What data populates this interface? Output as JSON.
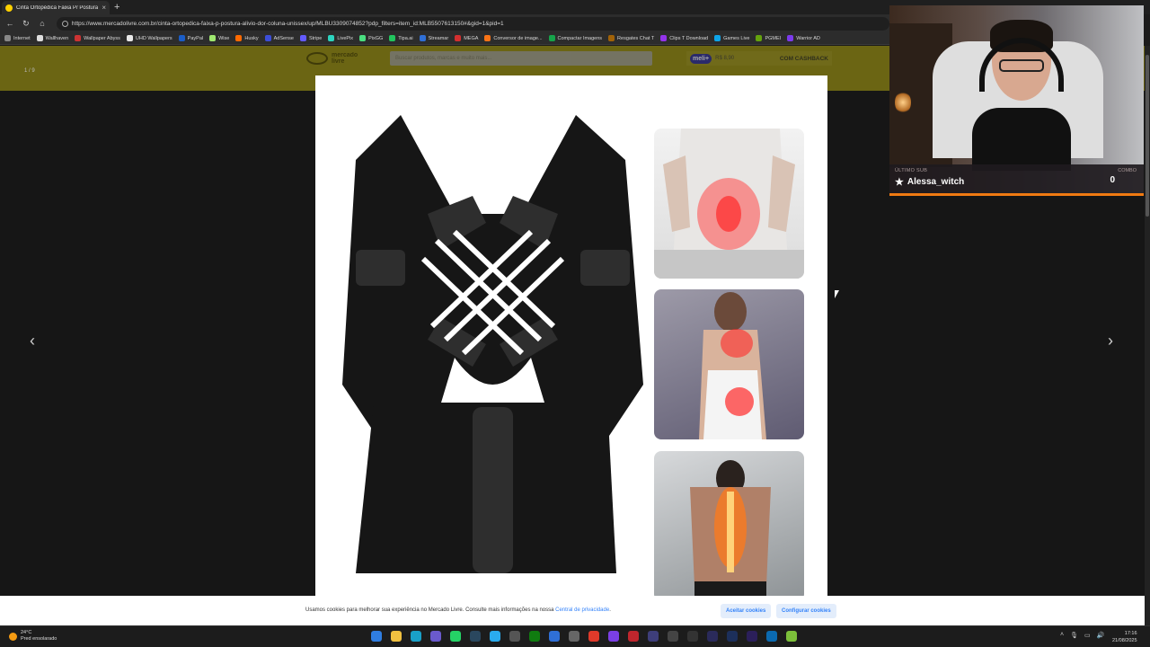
{
  "browser": {
    "tab_title": "Cinta Ortopédica Faixa P/ Postura",
    "new_tab": "+",
    "close": "×",
    "url": "https://www.mercadolivre.com.br/cinta-ortopedica-faixa-p-postura-alivio-dor-coluna-unissex/up/MLBU3309074852?pdp_filters=item_id:MLB5507613150#&gid=1&pid=1",
    "bookmarks": [
      "Internet",
      "Wallhaven",
      "Wallpaper Abyss",
      "UHD Wallpapers",
      "PayPal",
      "Wise",
      "Husky",
      "AdSense",
      "Stripe",
      "LivePix",
      "PixGG",
      "Tipa.ai",
      "Streamar",
      "MEGA",
      "Conversor de image...",
      "Compactar Imagens",
      "Resgates Chat T",
      "Clips T Download",
      "Games Live",
      "PGMEI",
      "Warrior AD"
    ]
  },
  "colors": {
    "ml_yellow": "#6b6513",
    "cookie_link": "#3483fa",
    "combo_bar": "#f07a12"
  },
  "gallery": {
    "counter": "1 / 9",
    "prev_icon": "chevron-left-icon",
    "next_icon": "chevron-right-icon"
  },
  "ml_header": {
    "logo_line1": "mercado",
    "logo_line2": "livre",
    "search_placeholder": "Buscar produtos, marcas e muito mais...",
    "promo_badge": "meli+",
    "promo_price": "R$ 8,90",
    "promo_cashback": "COM CASHBACK"
  },
  "cookie": {
    "text": "Usamos cookies para melhorar sua experiência no Mercado Livre. Consulte mais informações na nossa ",
    "link": "Central de privacidade",
    "after": ".",
    "accept": "Aceitar cookies",
    "configure": "Configurar cookies"
  },
  "stream_overlay": {
    "last_sub_label": "ÚLTIMO SUB",
    "last_sub_name": "Alessa_witch",
    "combo_label": "COMBO",
    "combo_value": "0"
  },
  "taskbar": {
    "temp": "24°C",
    "weather": "Pred ensolarado",
    "time": "17:16",
    "date": "21/08/2025"
  }
}
